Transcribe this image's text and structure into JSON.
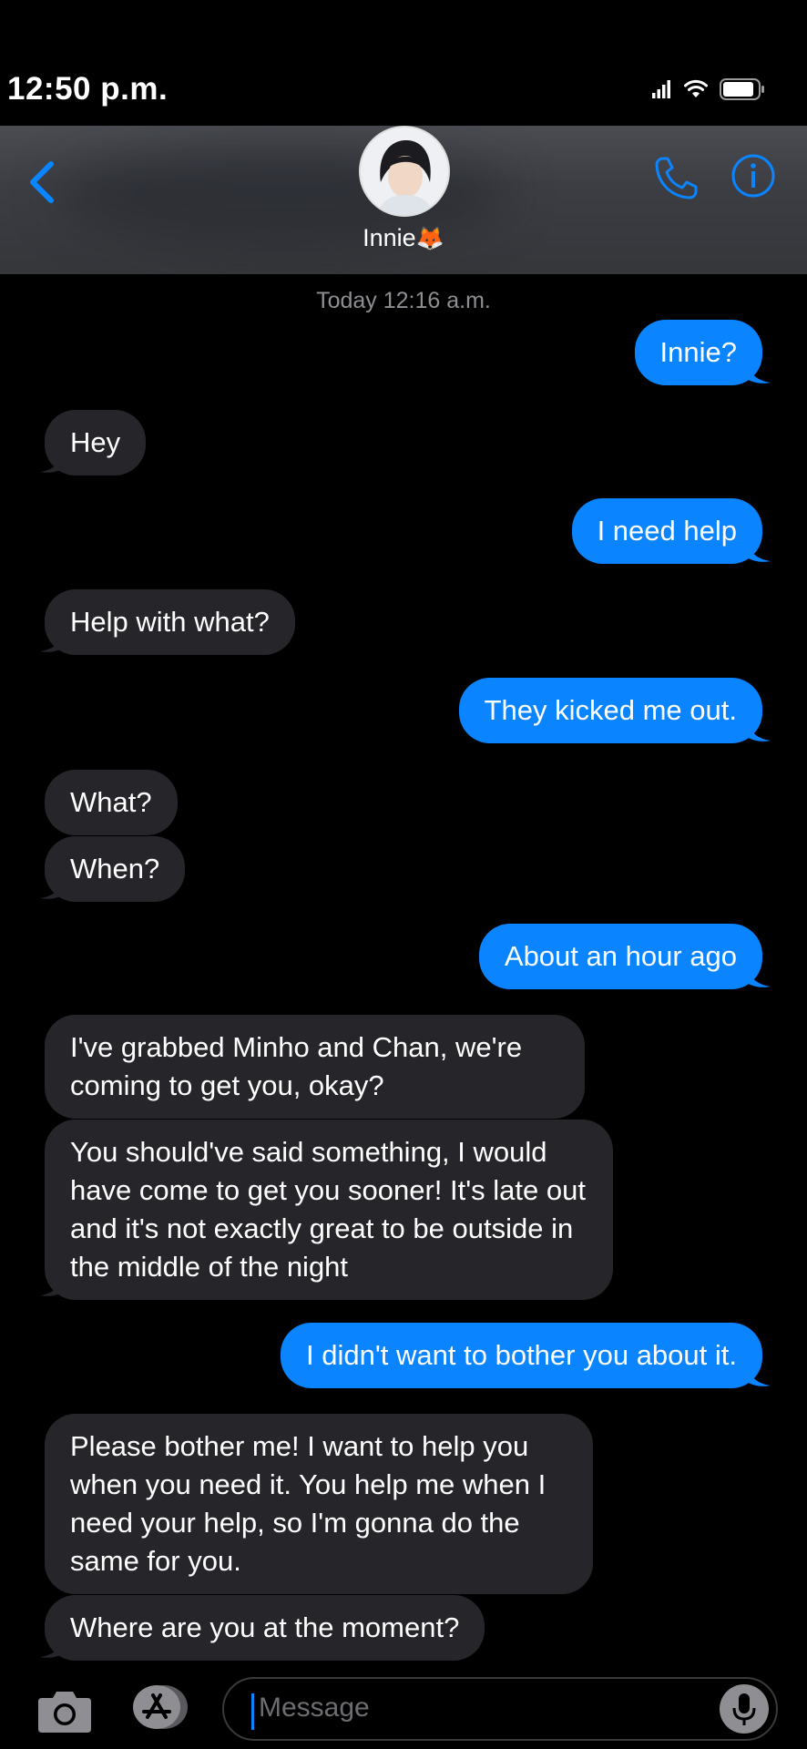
{
  "status_bar": {
    "time": "12:50 p.m."
  },
  "header": {
    "contact_name": "Innie",
    "contact_emoji": "🦊"
  },
  "thread": {
    "timestamp": "Today 12:16 a.m.",
    "messages": [
      {
        "from": "me",
        "text": "Innie?"
      },
      {
        "from": "them",
        "text": "Hey"
      },
      {
        "from": "me",
        "text": "I need help"
      },
      {
        "from": "them",
        "text": "Help with what?"
      },
      {
        "from": "me",
        "text": "They kicked me out."
      },
      {
        "from": "them",
        "text": "What?"
      },
      {
        "from": "them",
        "text": "When?"
      },
      {
        "from": "me",
        "text": "About an hour ago"
      },
      {
        "from": "them",
        "text": "I've grabbed Minho and Chan, we're coming to get you, okay?"
      },
      {
        "from": "them",
        "text": "You should've said something, I would have come to get you sooner! It's late out and it's not exactly great to be outside in the middle of the night"
      },
      {
        "from": "me",
        "text": "I didn't want to bother you about it."
      },
      {
        "from": "them",
        "text": "Please bother me! I want to help you when you need it. You help me when I need your help, so I'm gonna do the same for you."
      },
      {
        "from": "them",
        "text": "Where are you at the moment?"
      }
    ]
  },
  "composer": {
    "placeholder": "Message"
  },
  "colors": {
    "outgoing_bubble": "#0a84ff",
    "incoming_bubble": "#26252a",
    "accent": "#0a84ff"
  }
}
